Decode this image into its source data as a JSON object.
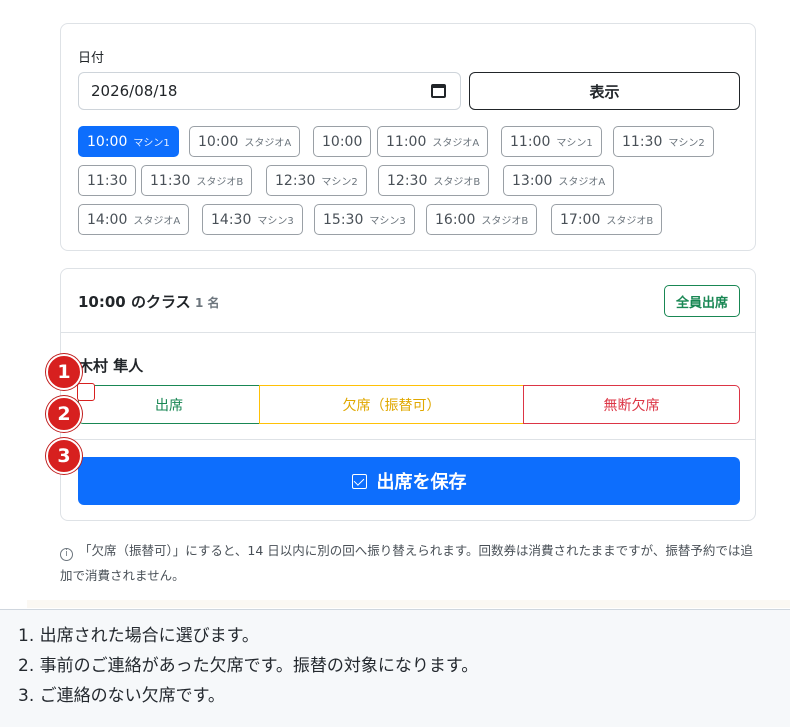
{
  "date_card": {
    "label": "日付",
    "date_value": "2026/08/18",
    "show_label": "表示",
    "chips": [
      {
        "time": "10:00",
        "loc": "マシン1",
        "active": true
      },
      {
        "time": "10:00",
        "loc": "スタジオA",
        "active": false
      },
      {
        "time": "10:00",
        "loc": "",
        "active": false
      },
      {
        "time": "11:00",
        "loc": "スタジオA",
        "active": false
      },
      {
        "time": "11:00",
        "loc": "マシン1",
        "active": false
      },
      {
        "time": "11:30",
        "loc": "マシン2",
        "active": false
      },
      {
        "time": "11:30",
        "loc": "",
        "active": false
      },
      {
        "time": "11:30",
        "loc": "スタジオB",
        "active": false
      },
      {
        "time": "12:30",
        "loc": "マシン2",
        "active": false
      },
      {
        "time": "12:30",
        "loc": "スタジオB",
        "active": false
      },
      {
        "time": "13:00",
        "loc": "スタジオA",
        "active": false
      },
      {
        "time": "14:00",
        "loc": "スタジオA",
        "active": false
      },
      {
        "time": "14:30",
        "loc": "マシン3",
        "active": false
      },
      {
        "time": "15:30",
        "loc": "マシン3",
        "active": false
      },
      {
        "time": "16:00",
        "loc": "スタジオB",
        "active": false
      },
      {
        "time": "17:00",
        "loc": "スタジオB",
        "active": false
      }
    ]
  },
  "class_card": {
    "title": "10:00 のクラス",
    "count": "1 名",
    "all_present_label": "全員出席",
    "student_name": "木村 隼人",
    "present_label": "出席",
    "absent_makeup_label": "欠席（振替可）",
    "no_notice_label": "無断欠席",
    "save_label": "出席を保存"
  },
  "note": {
    "info_icon": "i",
    "text": "「欠席（振替可）」にすると、14 日以内に別の回へ振り替えられます。回数券は消費されたままですが、振替予約では追加で消費されません。"
  },
  "markers": [
    "1",
    "2",
    "3"
  ],
  "legend": [
    "1. 出席された場合に選びます。",
    "2. 事前のご連絡があった欠席です。振替の対象になります。",
    "3. ご連絡のない欠席です。"
  ],
  "colors": {
    "primary": "#0d6efd",
    "success": "#198754",
    "warning": "#ffc107",
    "danger": "#dc3545",
    "marker": "#d7201f"
  }
}
